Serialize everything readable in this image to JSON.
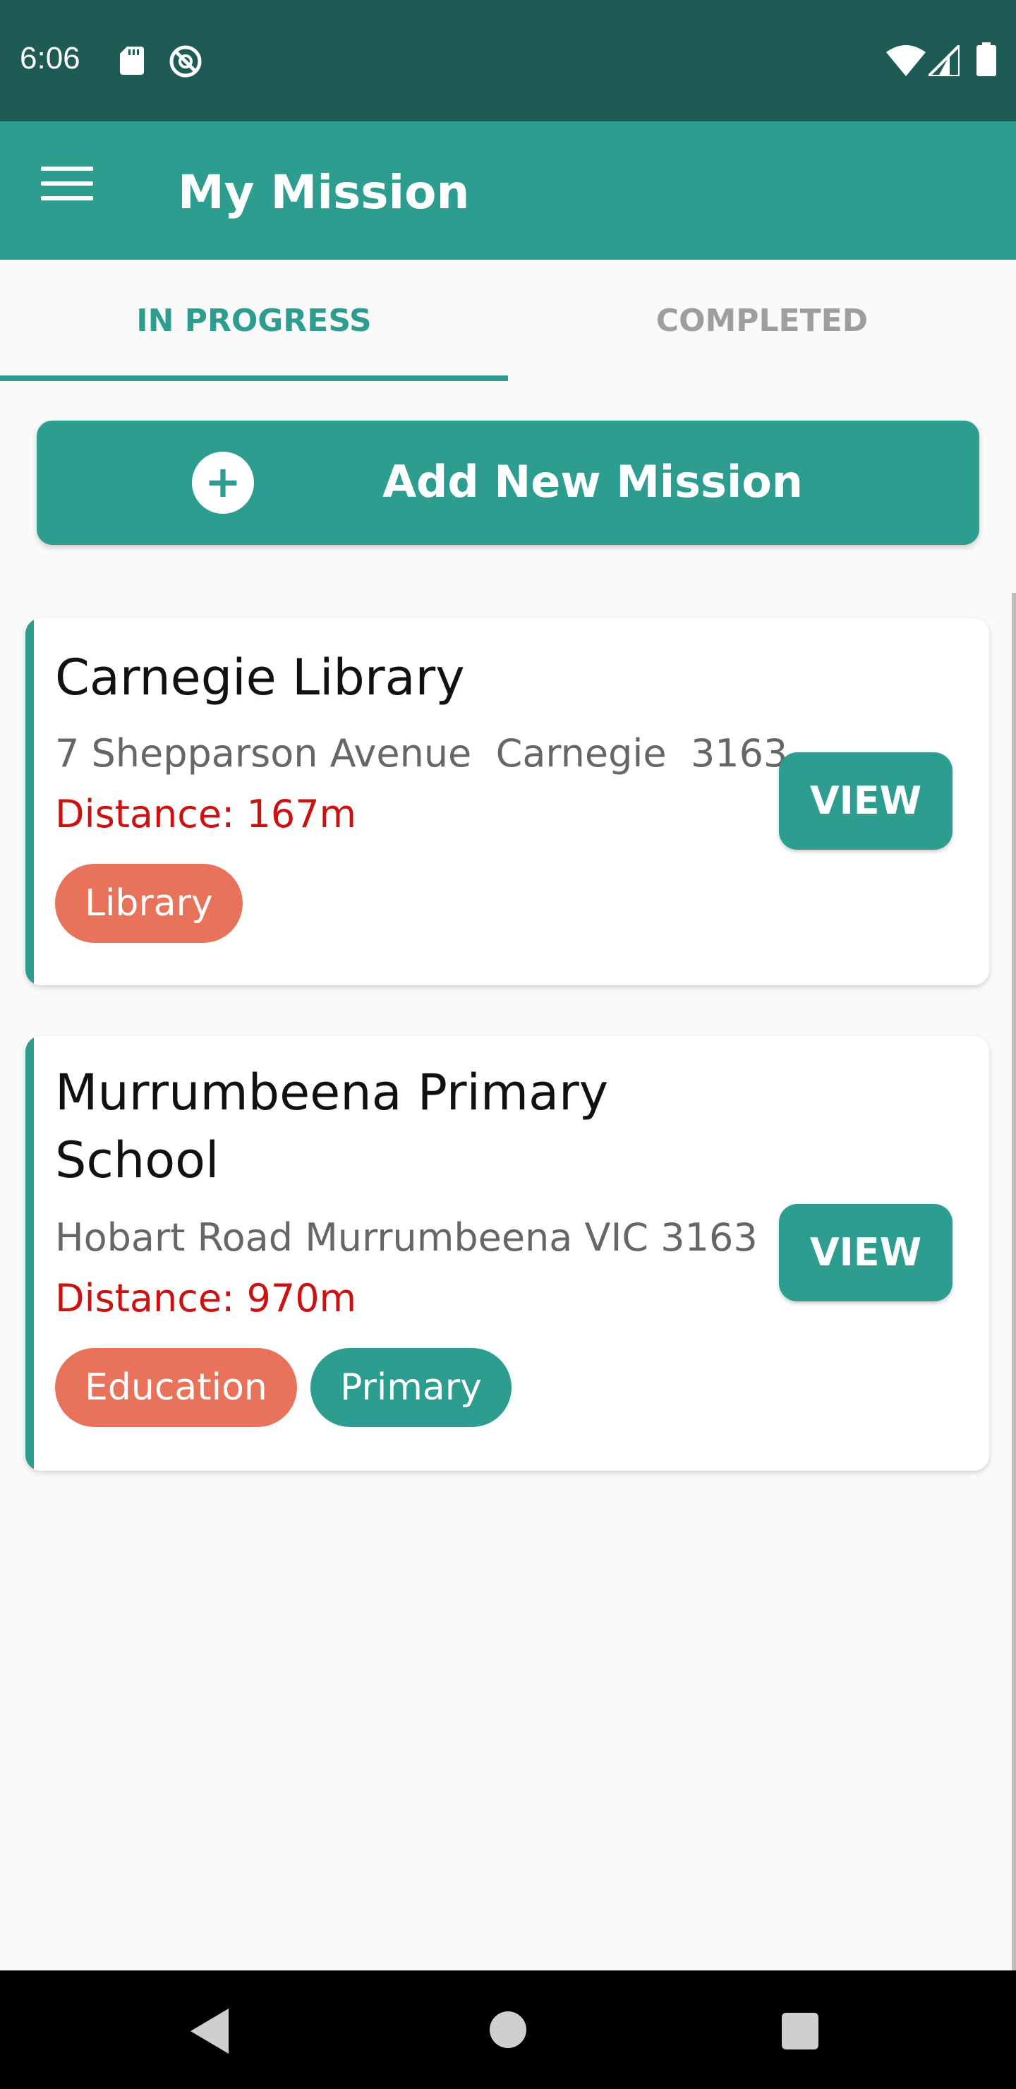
{
  "status_bar": {
    "time": "6:06",
    "icons": [
      "sd-card-icon",
      "sync-icon",
      "wifi-icon",
      "signal-icon",
      "battery-icon"
    ]
  },
  "app_bar": {
    "title": "My Mission",
    "menu_icon": "menu-icon"
  },
  "tabs": [
    {
      "label": "IN PROGRESS",
      "active": true
    },
    {
      "label": "COMPLETED",
      "active": false
    }
  ],
  "add_button": {
    "icon": "plus-circle-icon",
    "label": "Add New Mission"
  },
  "missions": [
    {
      "title": "Carnegie Library",
      "address": "7 Shepparson Avenue  Carnegie  3163",
      "distance": "Distance: 167m",
      "view_label": "VIEW",
      "tags": [
        {
          "label": "Library",
          "color": "#e8735a"
        }
      ]
    },
    {
      "title": "Murrumbeena Primary School",
      "address": "Hobart Road Murrumbeena VIC 3163",
      "distance": "Distance: 970m",
      "view_label": "VIEW",
      "tags": [
        {
          "label": "Education",
          "color": "#e8735a"
        },
        {
          "label": "Primary",
          "color": "#2c9d8e"
        }
      ]
    }
  ],
  "nav_bar": {
    "icons": [
      "back-icon",
      "home-icon",
      "recent-apps-icon"
    ]
  },
  "colors": {
    "status_bar": "#1e5b54",
    "primary": "#2c9d8e",
    "tag_orange": "#e8735a",
    "distance_red": "#cc1111"
  }
}
